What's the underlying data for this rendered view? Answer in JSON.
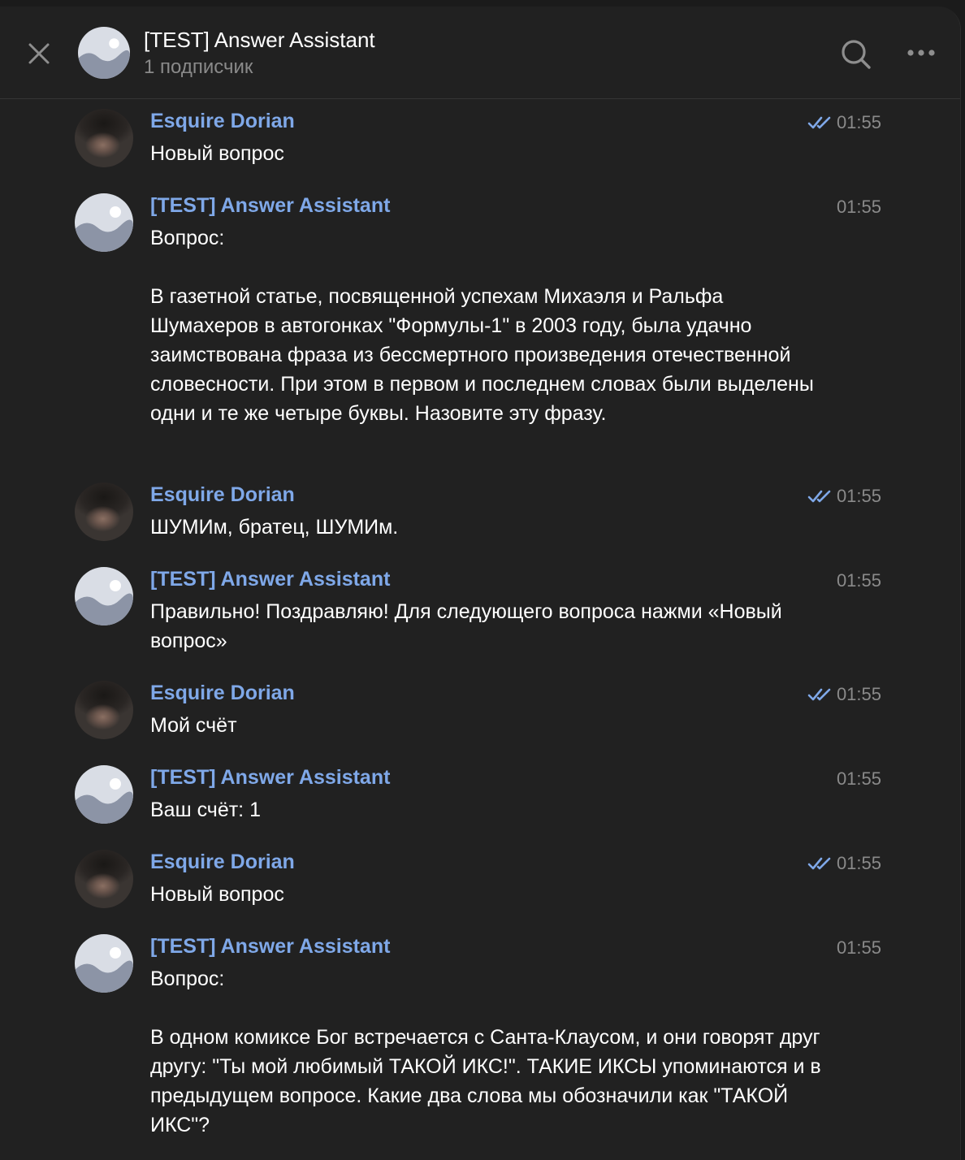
{
  "header": {
    "title": "[TEST] Answer Assistant",
    "subtitle": "1 подписчик"
  },
  "icons": {
    "close": "close-icon",
    "search": "search-icon",
    "more": "more-dots-icon",
    "read": "double-check-icon"
  },
  "colors": {
    "author": "#7fa8e8",
    "background": "#212121",
    "read_check": "#7fa8e8"
  },
  "messages": [
    {
      "author": "Esquire Dorian",
      "time": "01:55",
      "read": true,
      "avatar": "user-photo",
      "text": "Новый вопрос"
    },
    {
      "author": "[TEST] Answer Assistant",
      "time": "01:55",
      "read": false,
      "avatar": "bot-placeholder",
      "text": "Вопрос:\n\nВ газетной статье, посвященной успехам Михаэля и Ральфа Шумахеров в автогонках \"Формулы-1\" в 2003 году, была удачно заимствована фраза из бессмертного произведения отечественной словесности. При этом в первом и последнем словах были выделены одни и те же четыре буквы. Назовите эту фразу."
    },
    {
      "author": "Esquire Dorian",
      "time": "01:55",
      "read": true,
      "avatar": "user-photo",
      "text": "ШУМИм, братец, ШУМИм."
    },
    {
      "author": "[TEST] Answer Assistant",
      "time": "01:55",
      "read": false,
      "avatar": "bot-placeholder",
      "text": "Правильно! Поздравляю! Для следующего вопроса нажми «Новый вопрос»"
    },
    {
      "author": "Esquire Dorian",
      "time": "01:55",
      "read": true,
      "avatar": "user-photo",
      "text": "Мой счёт"
    },
    {
      "author": "[TEST] Answer Assistant",
      "time": "01:55",
      "read": false,
      "avatar": "bot-placeholder",
      "text": "Ваш счёт: 1"
    },
    {
      "author": "Esquire Dorian",
      "time": "01:55",
      "read": true,
      "avatar": "user-photo",
      "text": "Новый вопрос"
    },
    {
      "author": "[TEST] Answer Assistant",
      "time": "01:55",
      "read": false,
      "avatar": "bot-placeholder",
      "text": "Вопрос:\n\nВ одном комиксе Бог встречается с Санта-Клаусом, и они говорят друг другу: \"Ты мой любимый ТАКОЙ ИКС!\". ТАКИЕ ИКСЫ упоминаются и в предыдущем вопросе. Какие два слова мы обозначили как \"ТАКОЙ ИКС\"?"
    }
  ]
}
